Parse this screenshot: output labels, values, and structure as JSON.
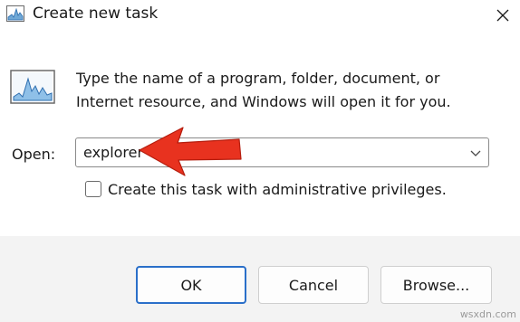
{
  "window": {
    "title": "Create new task",
    "close_icon": "close-icon"
  },
  "description": {
    "line1": "Type the name of a program, folder, document, or",
    "line2": "Internet resource, and Windows will open it for you."
  },
  "open": {
    "label": "Open:",
    "value": "explorer"
  },
  "admin_checkbox": {
    "label": "Create this task with administrative privileges.",
    "checked": false
  },
  "buttons": {
    "ok": "OK",
    "cancel": "Cancel",
    "browse": "Browse..."
  },
  "annotation": {
    "arrow_color": "#e8321f"
  },
  "watermark": "wsxdn.com",
  "colors": {
    "accent": "#2a6fc9",
    "footer_bg": "#f3f3f3"
  }
}
